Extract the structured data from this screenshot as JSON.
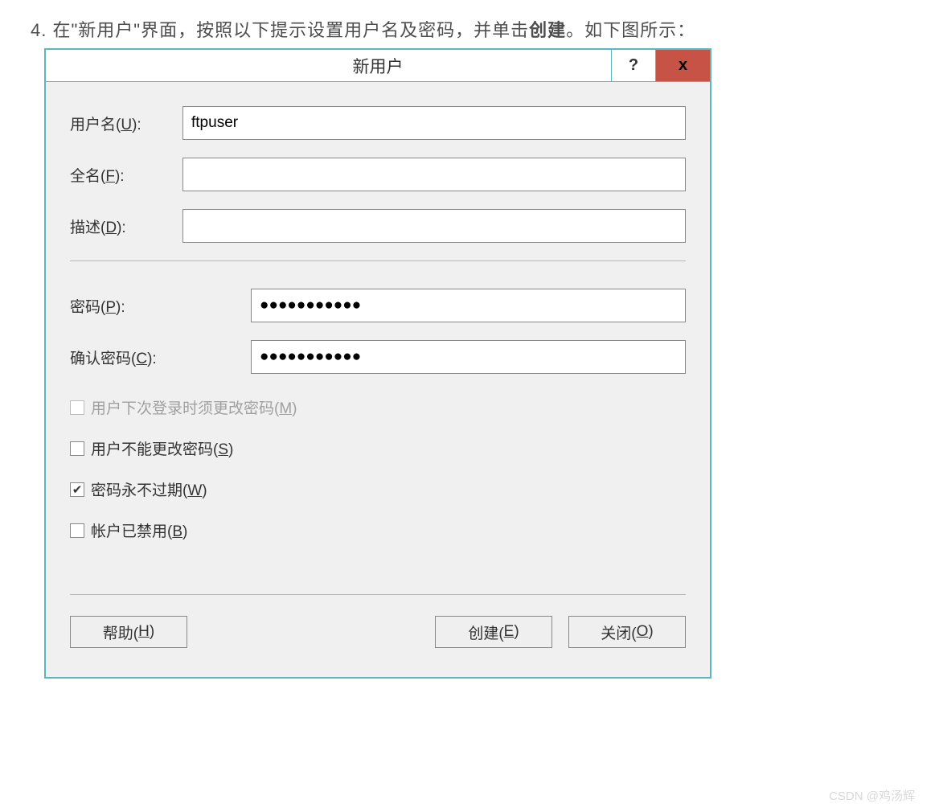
{
  "instruction": {
    "prefix": "4. 在\"新用户\"界面，按照以下提示设置用户名及密码，并单击",
    "bold": "创建",
    "suffix": "。如下图所示："
  },
  "dialog": {
    "title": "新用户",
    "help_symbol": "?",
    "close_symbol": "x",
    "fields": {
      "username": {
        "label_pre": "用户名(",
        "hotkey": "U",
        "label_post": "):",
        "value": "ftpuser"
      },
      "fullname": {
        "label_pre": "全名(",
        "hotkey": "F",
        "label_post": "):",
        "value": ""
      },
      "description": {
        "label_pre": "描述(",
        "hotkey": "D",
        "label_post": "):",
        "value": ""
      },
      "password": {
        "label_pre": "密码(",
        "hotkey": "P",
        "label_post": "):",
        "value": "●●●●●●●●●●●"
      },
      "confirm": {
        "label_pre": "确认密码(",
        "hotkey": "C",
        "label_post": "):",
        "value": "●●●●●●●●●●●"
      }
    },
    "checkboxes": {
      "must_change": {
        "label_pre": "用户下次登录时须更改密码(",
        "hotkey": "M",
        "label_post": ")",
        "checked": false,
        "disabled": true
      },
      "cannot_change": {
        "label_pre": "用户不能更改密码(",
        "hotkey": "S",
        "label_post": ")",
        "checked": false,
        "disabled": false
      },
      "never_expire": {
        "label_pre": "密码永不过期(",
        "hotkey": "W",
        "label_post": ")",
        "checked": true,
        "disabled": false
      },
      "disabled_acct": {
        "label_pre": "帐户已禁用(",
        "hotkey": "B",
        "label_post": ")",
        "checked": false,
        "disabled": false
      }
    },
    "buttons": {
      "help": {
        "label_pre": "帮助(",
        "hotkey": "H",
        "label_post": ")"
      },
      "create": {
        "label_pre": "创建(",
        "hotkey": "E",
        "label_post": ")"
      },
      "close": {
        "label_pre": "关闭(",
        "hotkey": "O",
        "label_post": ")"
      }
    }
  },
  "checkmark": "✔",
  "watermark": "CSDN @鸡汤辉"
}
